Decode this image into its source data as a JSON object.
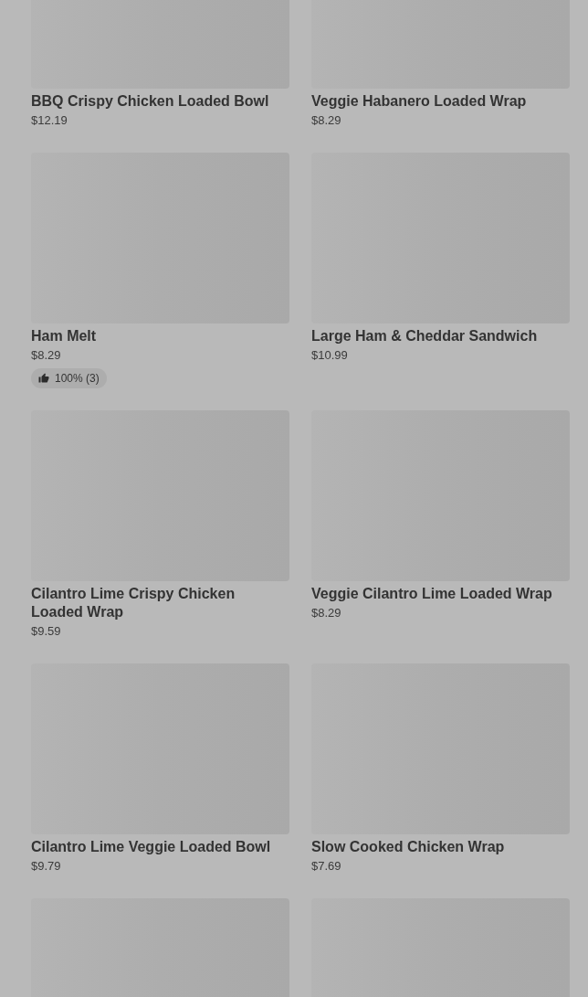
{
  "items": [
    {
      "kind": "product",
      "name": "BBQ Crispy Chicken Loaded Bowl",
      "price": "$12.19"
    },
    {
      "kind": "product",
      "name": "Veggie Habanero Loaded Wrap",
      "price": "$8.29"
    },
    {
      "kind": "product",
      "name": "Ham Melt",
      "price": "$8.29",
      "rating": "100% (3)"
    },
    {
      "kind": "product",
      "name": "Large Ham & Cheddar Sandwich",
      "price": "$10.99"
    },
    {
      "kind": "product",
      "name": "Cilantro Lime Crispy Chicken Loaded Wrap",
      "price": "$9.59"
    },
    {
      "kind": "product",
      "name": "Veggie Cilantro Lime Loaded Wrap",
      "price": "$8.29"
    },
    {
      "kind": "product",
      "name": "Cilantro Lime Veggie Loaded Bowl",
      "price": "$9.79"
    },
    {
      "kind": "product",
      "name": "Slow Cooked Chicken Wrap",
      "price": "$7.69"
    },
    {
      "kind": "image-only"
    },
    {
      "kind": "image-only"
    }
  ]
}
